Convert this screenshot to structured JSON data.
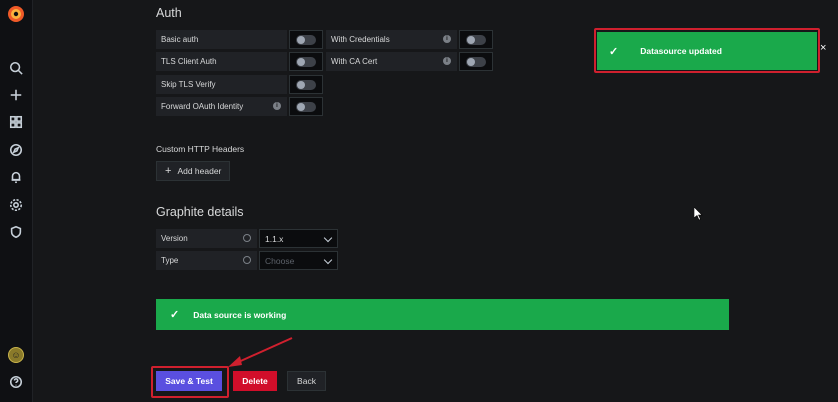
{
  "auth": {
    "title": "Auth",
    "rows_left": [
      {
        "label": "Basic auth"
      },
      {
        "label": "TLS Client Auth"
      },
      {
        "label": "Skip TLS Verify"
      },
      {
        "label": "Forward OAuth Identity"
      }
    ],
    "rows_right": [
      {
        "label": "With Credentials"
      },
      {
        "label": "With CA Cert"
      }
    ]
  },
  "headers": {
    "title": "Custom HTTP Headers",
    "add_label": "Add header"
  },
  "graphite": {
    "title": "Graphite details",
    "version_label": "Version",
    "version_value": "1.1.x",
    "type_label": "Type",
    "type_placeholder": "Choose"
  },
  "status": {
    "message": "Data source is working"
  },
  "actions": {
    "save_label": "Save & Test",
    "delete_label": "Delete",
    "back_label": "Back"
  },
  "toast": {
    "message": "Datasource updated",
    "close": "×"
  },
  "colors": {
    "success": "#1aa94b",
    "primary": "#5a4fe0",
    "danger": "#d10e2a",
    "highlight": "#d0202e"
  },
  "icons": {
    "sidebar": [
      "grafana-logo-icon",
      "search-icon",
      "plus-icon",
      "dashboards-icon",
      "explore-icon",
      "bell-icon",
      "gear-icon",
      "shield-icon",
      "user-avatar-icon",
      "help-icon"
    ]
  }
}
